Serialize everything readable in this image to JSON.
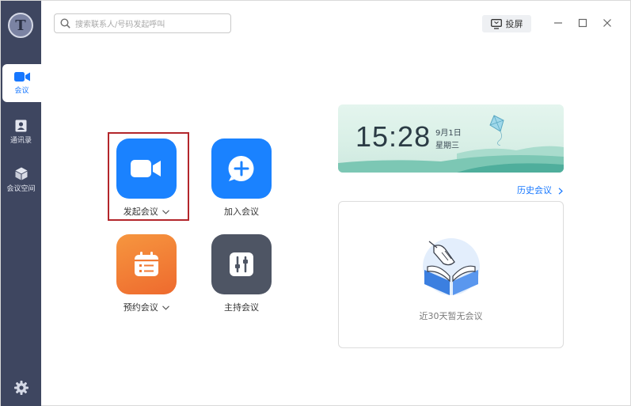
{
  "sidebar": {
    "avatar_letter": "T",
    "items": [
      {
        "label": "会议",
        "icon": "video-camera-icon",
        "active": true
      },
      {
        "label": "通讯录",
        "icon": "contacts-icon",
        "active": false
      },
      {
        "label": "会议空间",
        "icon": "cube-icon",
        "active": false
      }
    ],
    "settings_icon": "gear-icon"
  },
  "search": {
    "placeholder": "搜索联系人/号码发起呼叫"
  },
  "toolbar": {
    "cast_label": "投屏"
  },
  "actions": {
    "start_meeting": {
      "label": "发起会议",
      "color": "#1a82ff"
    },
    "join_meeting": {
      "label": "加入会议",
      "color": "#1a82ff"
    },
    "schedule_meeting": {
      "label": "预约会议",
      "color": "#f27a35"
    },
    "host_meeting": {
      "label": "主持会议",
      "color": "#4e5564"
    }
  },
  "clock": {
    "time": "15:28",
    "date": "9月1日",
    "weekday": "星期三"
  },
  "history_link": "历史会议",
  "empty_state": {
    "text": "近30天暂无会议"
  },
  "colors": {
    "accent": "#1677ff",
    "sidebar": "#3e4660",
    "highlight": "#b3262b"
  }
}
